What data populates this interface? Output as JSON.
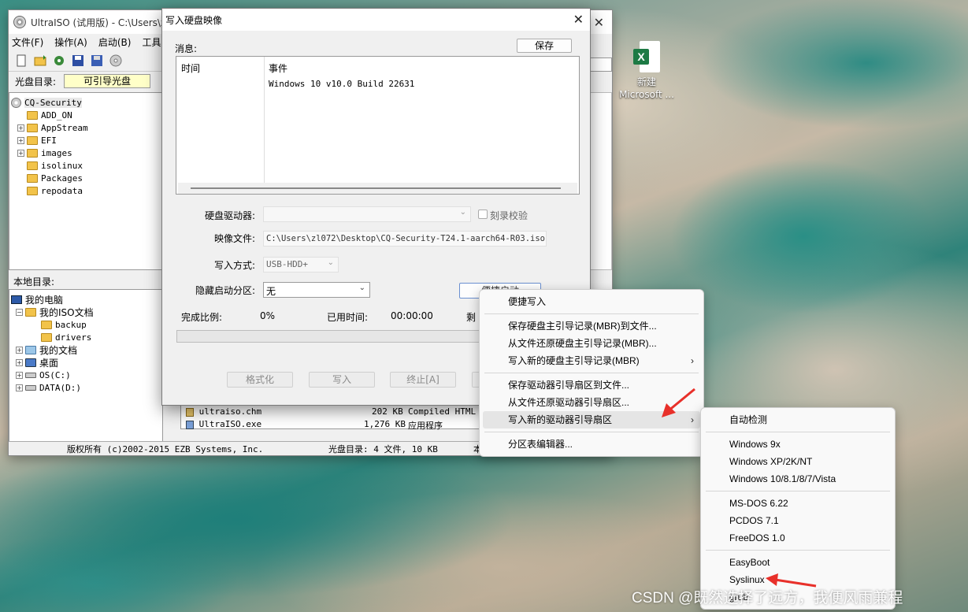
{
  "desktop": {
    "icon_label_line1": "新建",
    "icon_label_line2": "Microsoft ..."
  },
  "main_window": {
    "title": "UltraISO (试用版) - C:\\Users\\zl0",
    "menu": [
      "文件(F)",
      "操作(A)",
      "启动(B)",
      "工具("
    ],
    "disc_dir_label": "光盘目录:",
    "disc_type": "可引导光盘",
    "iso_tree": [
      "CQ-Security",
      "ADD_ON",
      "AppStream",
      "EFI",
      "images",
      "isolinux",
      "Packages",
      "repodata"
    ],
    "local_dir_label": "本地目录:",
    "local_tree": [
      "我的电脑",
      "我的ISO文档",
      "backup",
      "drivers",
      "我的文档",
      "桌面",
      "OS(C:)",
      "DATA(D:)"
    ],
    "files": [
      {
        "name": "ultraiso.chm",
        "size": "202 KB",
        "type": "Compiled HTML H"
      },
      {
        "name": "UltraISO.exe",
        "size": "1,276 KB",
        "type": "应用程序"
      }
    ],
    "status_copyright": "版权所有 (c)2002-2015 EZB Systems, Inc.",
    "status_disc": "光盘目录: 4 文件, 10 KB",
    "status_more": "本"
  },
  "dialog": {
    "title": "写入硬盘映像",
    "messages_label": "消息:",
    "save_label": "保存",
    "log_col_time": "时间",
    "log_col_event": "事件",
    "log_entry": "Windows 10 v10.0 Build 22631",
    "drive_label": "硬盘驱动器:",
    "verify_label": "刻录校验",
    "image_label": "映像文件:",
    "image_path": "C:\\Users\\zl072\\Desktop\\CQ-Security-T24.1-aarch64-R03.iso",
    "write_mode_label": "写入方式:",
    "write_mode": "USB-HDD+",
    "hidden_part_label": "隐藏启动分区:",
    "hidden_part_value": "无",
    "boot_btn_label": "便捷启动",
    "percent_label": "完成比例:",
    "percent_value": "0%",
    "elapsed_label": "已用时间:",
    "elapsed_value": "00:00:00",
    "remaining_label": "剩",
    "format_btn": "格式化",
    "write_btn": "写入",
    "stop_btn": "终止[A]"
  },
  "context_menu": {
    "items": [
      {
        "label": "便捷写入"
      },
      {
        "sep": true
      },
      {
        "label": "保存硬盘主引导记录(MBR)到文件..."
      },
      {
        "label": "从文件还原硬盘主引导记录(MBR)..."
      },
      {
        "label": "写入新的硬盘主引导记录(MBR)",
        "submenu": true
      },
      {
        "sep": true
      },
      {
        "label": "保存驱动器引导扇区到文件..."
      },
      {
        "label": "从文件还原驱动器引导扇区..."
      },
      {
        "label": "写入新的驱动器引导扇区",
        "submenu": true,
        "highlighted": true
      },
      {
        "sep": true
      },
      {
        "label": "分区表编辑器..."
      }
    ]
  },
  "submenu": {
    "items": [
      {
        "label": "自动检测"
      },
      {
        "sep": true
      },
      {
        "label": "Windows 9x"
      },
      {
        "label": "Windows XP/2K/NT"
      },
      {
        "label": "Windows 10/8.1/8/7/Vista"
      },
      {
        "sep": true
      },
      {
        "label": "MS-DOS 6.22"
      },
      {
        "label": "PCDOS 7.1"
      },
      {
        "label": "FreeDOS 1.0"
      },
      {
        "sep": true
      },
      {
        "label": "EasyBoot"
      },
      {
        "label": "Syslinux"
      },
      {
        "label": "grub"
      }
    ]
  },
  "watermark": "CSDN @既然选择了远方，我便风雨兼程",
  "colors": {
    "arrow": "#e8302a",
    "disc_box": "#ffffc8",
    "menu_highlight": "#e5e5e5"
  }
}
